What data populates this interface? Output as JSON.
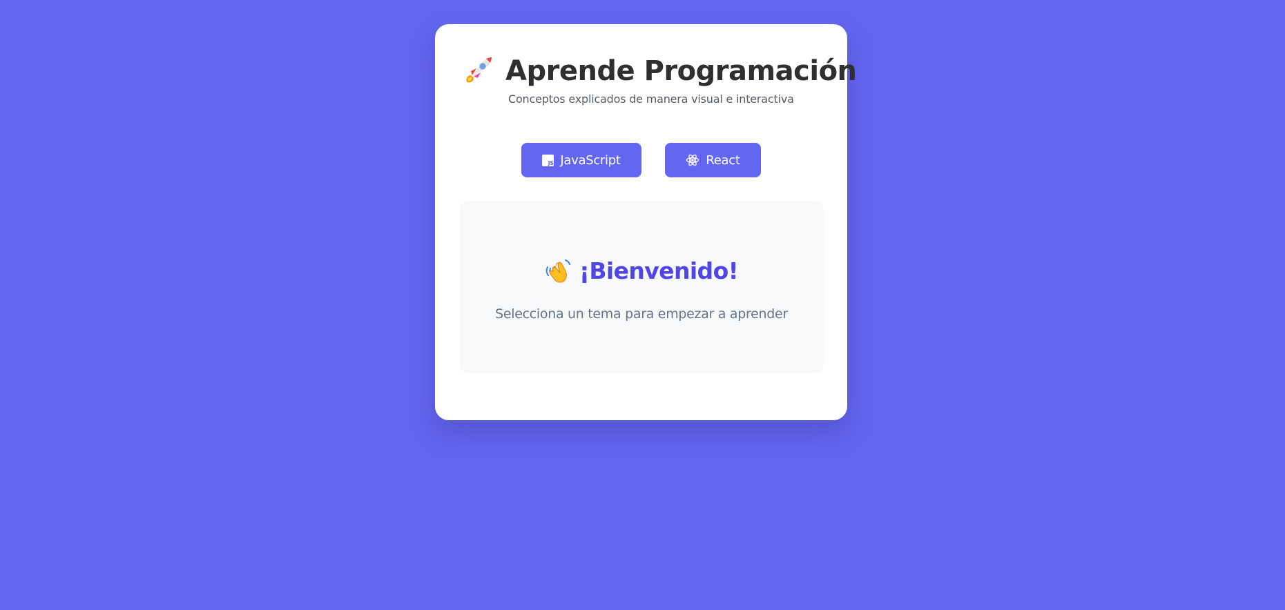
{
  "header": {
    "title": "Aprende Programación",
    "subtitle": "Conceptos explicados de manera visual e interactiva",
    "icon": "rocket-icon"
  },
  "topics": {
    "javascript_label": "JavaScript",
    "javascript_icon": "js-icon",
    "react_label": "React",
    "react_icon": "react-icon"
  },
  "welcome": {
    "title": "¡Bienvenido!",
    "subtitle": "Selecciona un tema para empezar a aprender",
    "icon": "waving-hand-icon"
  },
  "colors": {
    "background": "#6366f1",
    "button": "#6366f1",
    "welcome_title": "#4f46e5",
    "panel": "#f8f9fb"
  }
}
